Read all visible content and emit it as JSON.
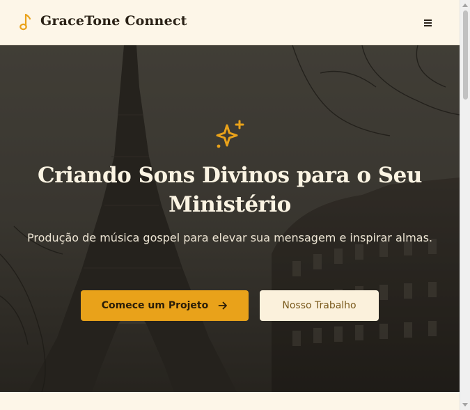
{
  "header": {
    "brand": "GraceTone Connect",
    "logo_icon": "music-note-icon",
    "menu_icon": "hamburger-menu-icon"
  },
  "hero": {
    "icon": "sparkles-icon",
    "title": "Criando Sons Divinos para o Seu Ministério",
    "subtitle": "Produção de música gospel para elevar sua mensagem e inspirar almas.",
    "primary_button": {
      "label": "Comece um Projeto",
      "icon": "arrow-right-icon"
    },
    "secondary_button": {
      "label": "Nosso Trabalho"
    },
    "background_image": "paris-street-eiffel-tower-photo"
  },
  "colors": {
    "accent": "#e9a21a",
    "page_background": "#fdf6e8",
    "header_text": "#2a2116",
    "secondary_button_bg": "#fbf1dc",
    "secondary_button_text": "#7a5a1d",
    "hero_text": "#fbf4e3"
  }
}
